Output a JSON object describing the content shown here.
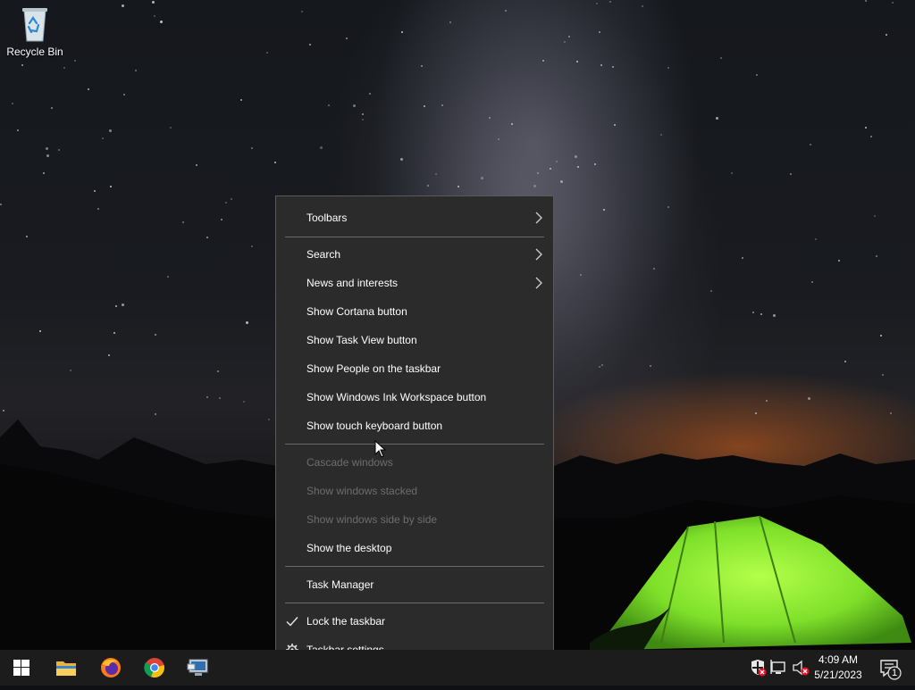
{
  "desktop": {
    "recycle_bin_label": "Recycle Bin"
  },
  "context_menu": {
    "items": [
      {
        "label": "Toolbars",
        "submenu": true,
        "enabled": true
      },
      {
        "label": "Search",
        "submenu": true,
        "enabled": true
      },
      {
        "label": "News and interests",
        "submenu": true,
        "enabled": true
      },
      {
        "label": "Show Cortana button",
        "enabled": true
      },
      {
        "label": "Show Task View button",
        "enabled": true
      },
      {
        "label": "Show People on the taskbar",
        "enabled": true
      },
      {
        "label": "Show Windows Ink Workspace button",
        "enabled": true
      },
      {
        "label": "Show touch keyboard button",
        "enabled": true
      },
      {
        "label": "Cascade windows",
        "enabled": false
      },
      {
        "label": "Show windows stacked",
        "enabled": false
      },
      {
        "label": "Show windows side by side",
        "enabled": false
      },
      {
        "label": "Show the desktop",
        "enabled": true
      },
      {
        "label": "Task Manager",
        "enabled": true
      },
      {
        "label": "Lock the taskbar",
        "enabled": true,
        "checked": true
      },
      {
        "label": "Taskbar settings",
        "enabled": true,
        "icon": "gear-icon"
      }
    ]
  },
  "taskbar": {
    "pinned": [
      "start-icon",
      "file-explorer-icon",
      "firefox-icon",
      "chrome-icon",
      "network-app-icon"
    ],
    "tray_icons": [
      "security-warning-icon",
      "network-icon",
      "volume-muted-icon"
    ],
    "clock_time": "4:09 AM",
    "clock_date": "5/21/2023",
    "notification_count": "1"
  },
  "colors": {
    "menu_bg": "#2b2b2b",
    "menu_text": "#ffffff",
    "menu_disabled_text": "#6d6d6d",
    "taskbar_bg": "#1c1c1c"
  }
}
